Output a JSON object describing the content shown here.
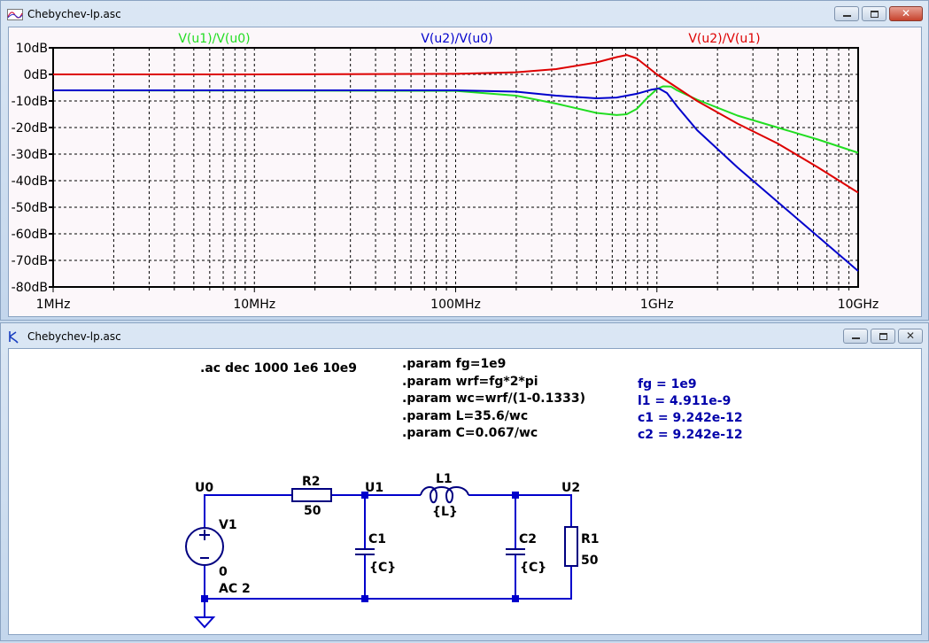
{
  "plot_window": {
    "title": "Chebychev-lp.asc",
    "icon": "waveform-icon",
    "controls": {
      "minimize": "minimize-icon",
      "maximize": "maximize-icon",
      "close": "close-icon"
    }
  },
  "schematic_window": {
    "title": "Chebychev-lp.asc",
    "icon": "schematic-icon",
    "controls": {
      "minimize": "minimize-icon",
      "maximize": "maximize-icon",
      "close": "close-icon"
    }
  },
  "chart_data": {
    "type": "line",
    "title": "",
    "xscale": "log",
    "xlim": [
      1000000.0,
      10000000000.0
    ],
    "ylim": [
      -80,
      10
    ],
    "grid": true,
    "xticks": [
      {
        "v": 6,
        "label": "1MHz"
      },
      {
        "v": 7,
        "label": "10MHz"
      },
      {
        "v": 8,
        "label": "100MHz"
      },
      {
        "v": 9,
        "label": "1GHz"
      },
      {
        "v": 10,
        "label": "10GHz"
      }
    ],
    "yticks": [
      {
        "v": 10,
        "label": "10dB"
      },
      {
        "v": 0,
        "label": "0dB"
      },
      {
        "v": -10,
        "label": "-10dB"
      },
      {
        "v": -20,
        "label": "-20dB"
      },
      {
        "v": -30,
        "label": "-30dB"
      },
      {
        "v": -40,
        "label": "-40dB"
      },
      {
        "v": -50,
        "label": "-50dB"
      },
      {
        "v": -60,
        "label": "-60dB"
      },
      {
        "v": -70,
        "label": "-70dB"
      },
      {
        "v": -80,
        "label": "-80dB"
      }
    ],
    "series": [
      {
        "name": "V(u1)/V(u0)",
        "color": "#22dd22",
        "log10_freq": [
          6,
          8,
          8.3,
          8.5,
          8.7,
          8.8,
          8.85,
          8.9,
          8.95,
          9.0,
          9.03,
          9.07,
          9.1,
          9.2,
          9.4,
          9.6,
          9.8,
          10
        ],
        "db": [
          -6,
          -6.2,
          -8,
          -11,
          -14.5,
          -15.3,
          -15,
          -13,
          -9,
          -5.5,
          -4.5,
          -4.6,
          -6,
          -9.5,
          -15.5,
          -20,
          -24.5,
          -29.5
        ]
      },
      {
        "name": "V(u2)/V(u0)",
        "color": "#0000cc",
        "log10_freq": [
          6,
          8,
          8.3,
          8.5,
          8.7,
          8.8,
          8.9,
          8.97,
          9.01,
          9.05,
          9.1,
          9.2,
          9.4,
          9.6,
          9.8,
          10
        ],
        "db": [
          -6,
          -6,
          -6.5,
          -8,
          -9,
          -8.7,
          -7.3,
          -5.8,
          -5.3,
          -7,
          -12,
          -21,
          -35,
          -48,
          -61,
          -74
        ]
      },
      {
        "name": "V(u2)/V(u1)",
        "color": "#dd0000",
        "log10_freq": [
          6,
          7,
          8,
          8.3,
          8.5,
          8.7,
          8.8,
          8.85,
          8.9,
          9.0,
          9.1,
          9.2,
          9.4,
          9.6,
          9.8,
          10
        ],
        "db": [
          0,
          0,
          0.2,
          0.8,
          2,
          4.5,
          6.5,
          7.3,
          6,
          0,
          -5,
          -10,
          -18.5,
          -26,
          -35,
          -44.5
        ]
      }
    ]
  },
  "schematic": {
    "directive_ac": ".ac dec 1000 1e6 10e9",
    "params": [
      ".param fg=1e9",
      ".param wrf=fg*2*pi",
      ".param wc=wrf/(1-0.1333)",
      ".param L=35.6/wc",
      ".param C=0.067/wc"
    ],
    "measurements": [
      "fg = 1e9",
      "l1 = 4.911e-9",
      "c1 = 9.242e-12",
      "c2 = 9.242e-12"
    ],
    "nets": {
      "u0": "U0",
      "u1": "U1",
      "u2": "U2"
    },
    "components": {
      "r2": {
        "name": "R2",
        "value": "50"
      },
      "l1": {
        "name": "L1",
        "value": "{L}"
      },
      "c1": {
        "name": "C1",
        "value": "{C}"
      },
      "c2": {
        "name": "C2",
        "value": "{C}"
      },
      "r1": {
        "name": "R1",
        "value": "50"
      },
      "v1": {
        "name": "V1",
        "value": "0",
        "ac": "AC 2"
      }
    },
    "wire_color": "#0000cc",
    "text_color": "#000000",
    "measure_color": "#0000aa"
  }
}
